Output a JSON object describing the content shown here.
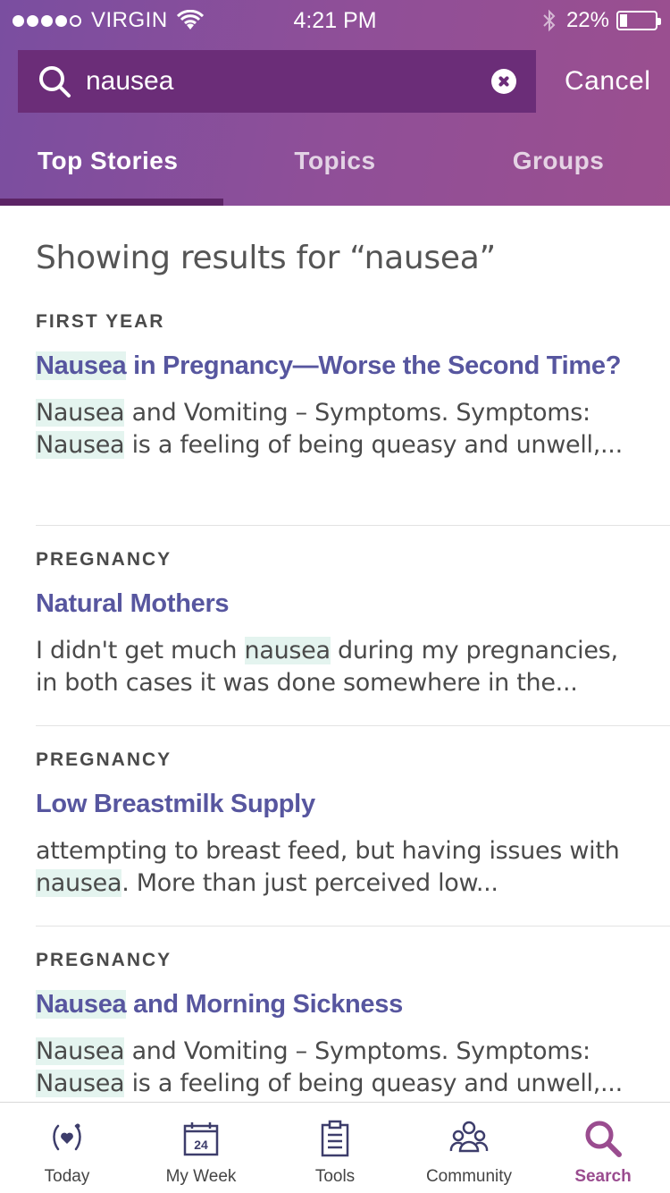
{
  "status_bar": {
    "carrier": "VIRGIN",
    "time": "4:21 PM",
    "battery": "22%",
    "battery_level": 0.22,
    "signal_bars_filled": 4,
    "signal_bars_total": 5
  },
  "search": {
    "value": "nausea",
    "cancel_label": "Cancel",
    "icon": "search-icon"
  },
  "tabs": [
    {
      "label": "Top Stories",
      "active": true
    },
    {
      "label": "Topics",
      "active": false
    },
    {
      "label": "Groups",
      "active": false
    }
  ],
  "results_heading": "Showing results for “nausea”",
  "highlight_color": "#e4f4ef",
  "title_color": "#57569f",
  "accent_color": "#9a4c8f",
  "results": [
    {
      "category": "FIRST YEAR",
      "title_hl": "Nausea",
      "title_rest": " in Pregnancy—Worse the Second Time?",
      "snippet_parts": [
        {
          "text": "Nausea",
          "hl": true
        },
        {
          "text": " and Vomiting – Symptoms. Symptoms: ",
          "hl": false
        },
        {
          "text": "Nausea",
          "hl": true
        },
        {
          "text": " is a feeling of being queasy and unwell,...",
          "hl": false
        }
      ]
    },
    {
      "category": "PREGNANCY",
      "title_hl": "",
      "title_rest": "Natural Mothers",
      "snippet_parts": [
        {
          "text": "I didn't get much ",
          "hl": false
        },
        {
          "text": "nausea",
          "hl": true
        },
        {
          "text": " during my pregnancies, in both cases it was done somewhere in the...",
          "hl": false
        }
      ]
    },
    {
      "category": "PREGNANCY",
      "title_hl": "",
      "title_rest": "Low Breastmilk Supply",
      "snippet_parts": [
        {
          "text": "attempting to breast feed, but having issues with ",
          "hl": false
        },
        {
          "text": "nausea",
          "hl": true
        },
        {
          "text": ". More than just perceived low...",
          "hl": false
        }
      ]
    },
    {
      "category": "PREGNANCY",
      "title_hl": "Nausea",
      "title_rest": " and Morning Sickness",
      "snippet_parts": [
        {
          "text": "Nausea",
          "hl": true
        },
        {
          "text": " and Vomiting – Symptoms. Symptoms: ",
          "hl": false
        },
        {
          "text": "Nausea",
          "hl": true
        },
        {
          "text": " is a feeling of being queasy and unwell,...",
          "hl": false
        }
      ]
    }
  ],
  "tab_bar": [
    {
      "label": "Today",
      "icon": "today-icon",
      "active": false
    },
    {
      "label": "My Week",
      "icon": "calendar-icon",
      "calendar_day": "24",
      "active": false
    },
    {
      "label": "Tools",
      "icon": "clipboard-icon",
      "active": false
    },
    {
      "label": "Community",
      "icon": "community-icon",
      "active": false
    },
    {
      "label": "Search",
      "icon": "search-icon",
      "active": true
    }
  ]
}
